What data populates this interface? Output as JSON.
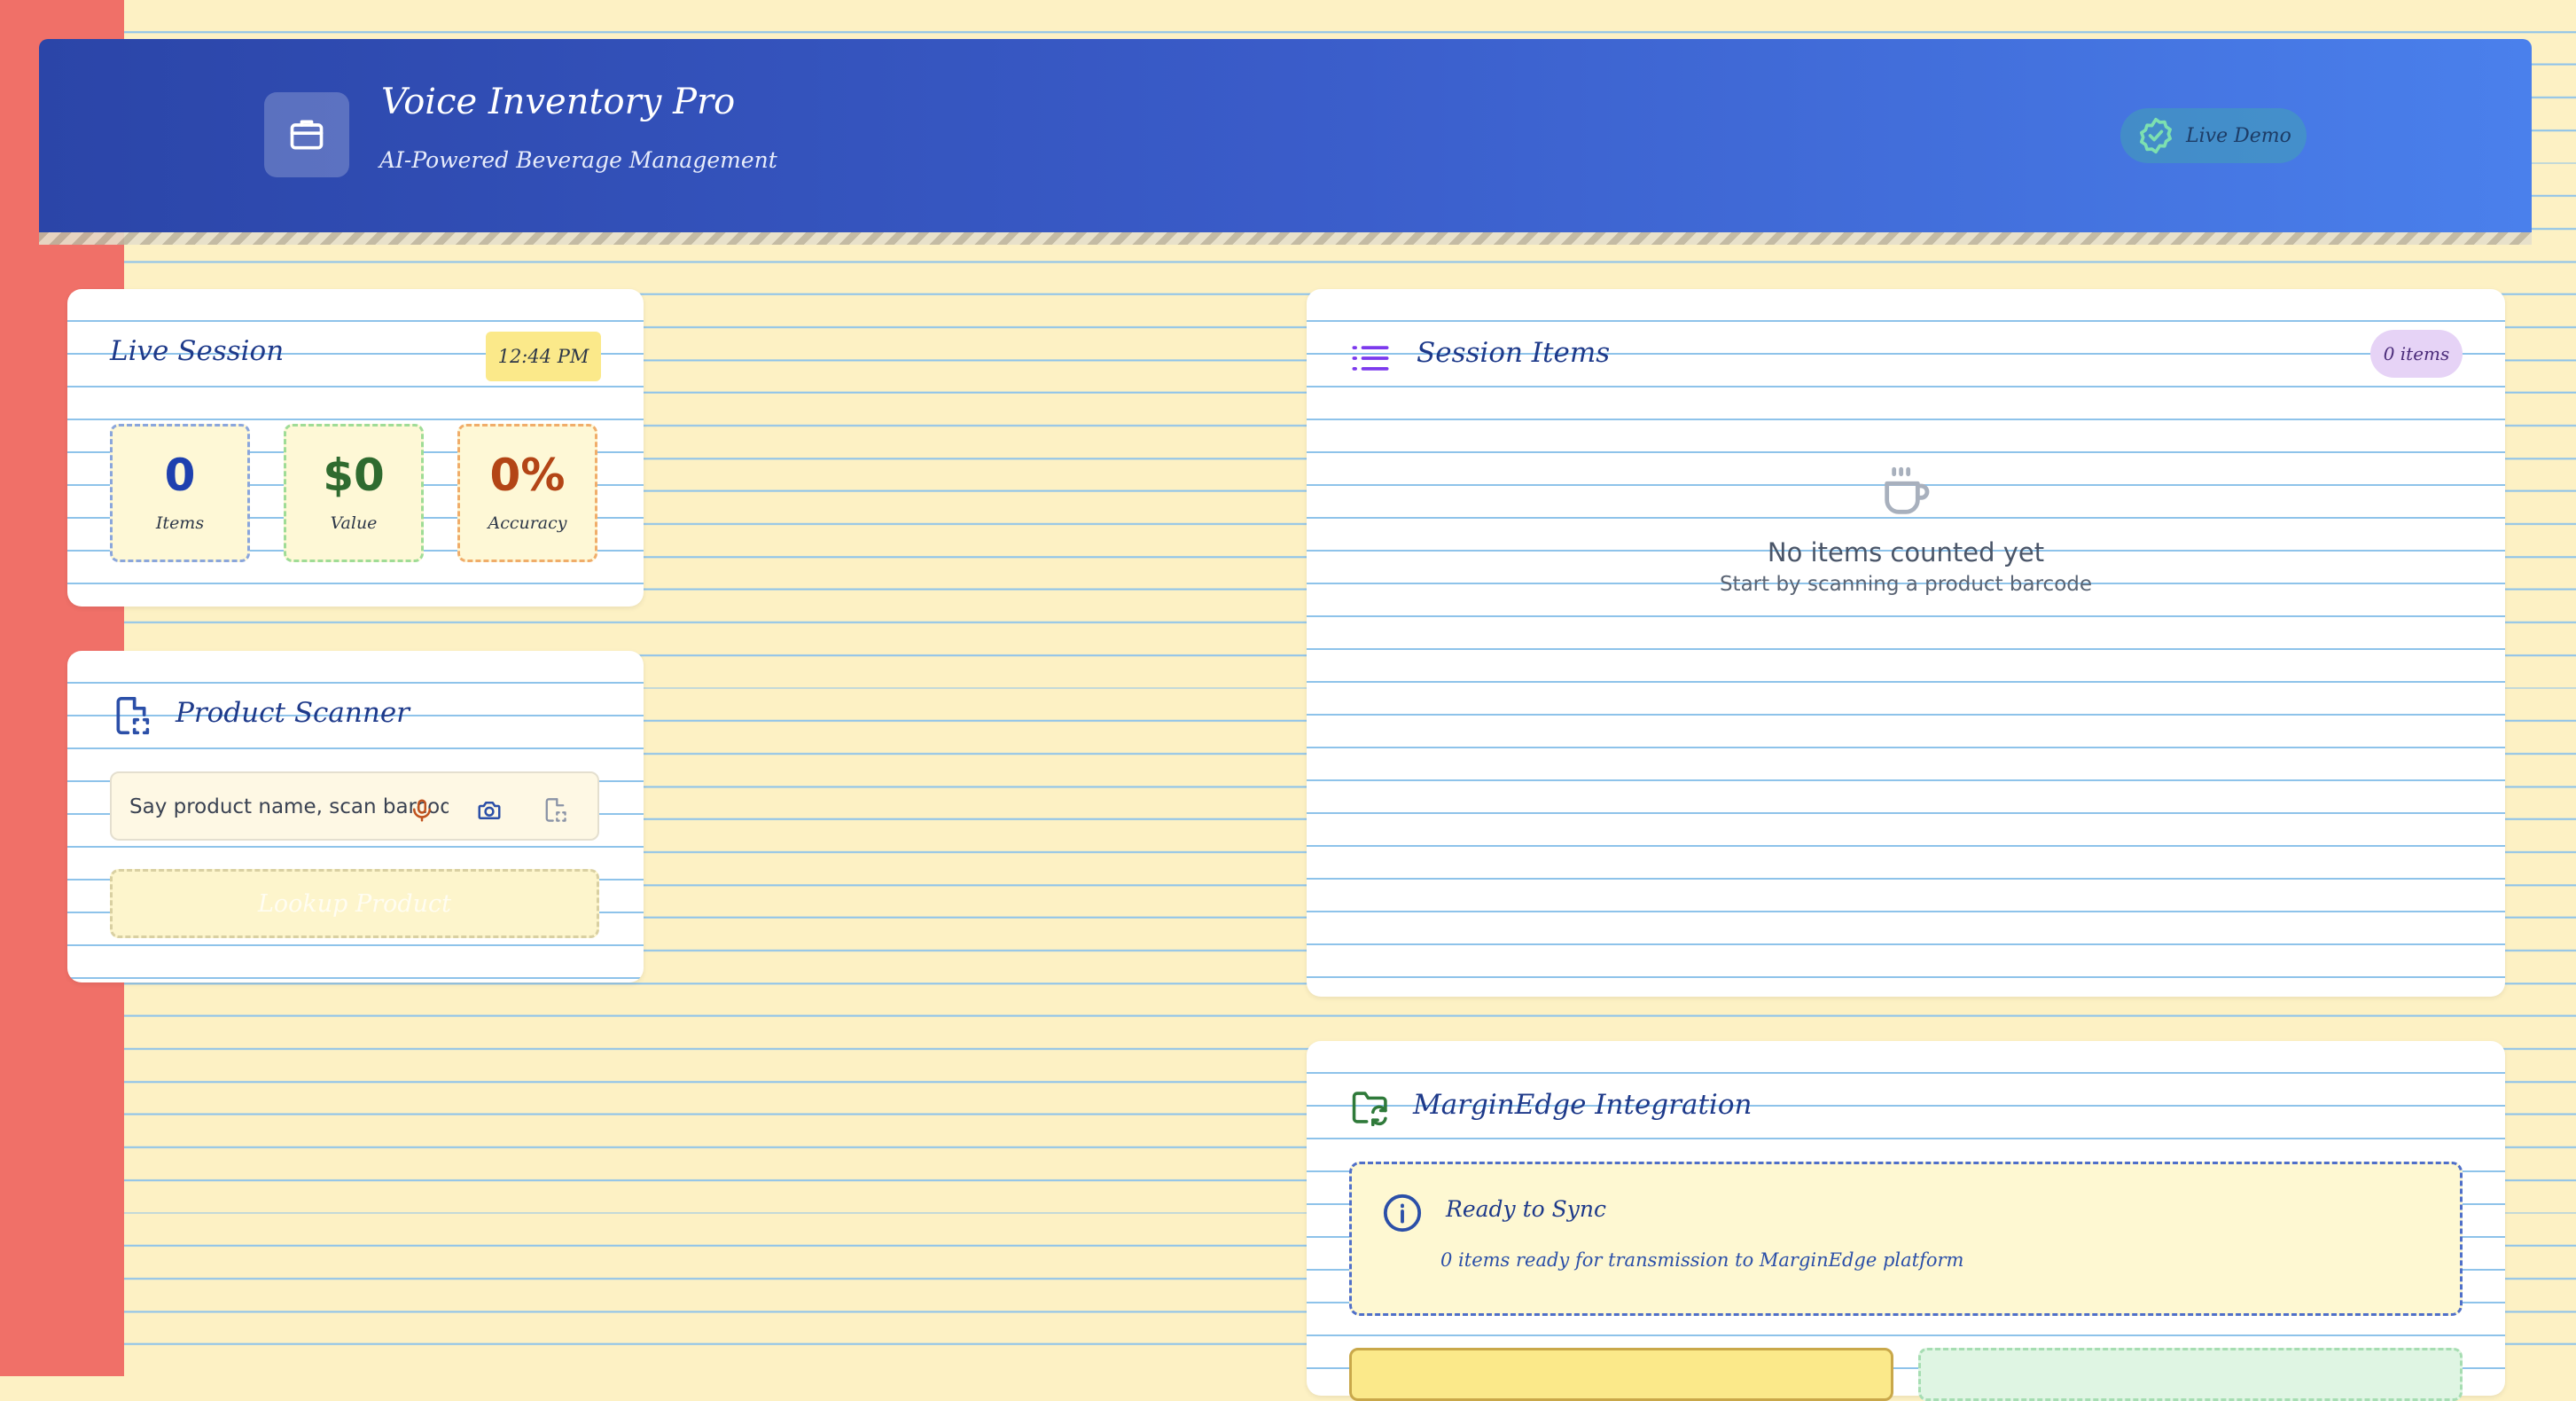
{
  "header": {
    "title": "Voice Inventory Pro",
    "subtitle": "AI-Powered Beverage Management",
    "status": "Live Demo"
  },
  "session": {
    "title": "Live Session",
    "time": "12:44 PM",
    "stats": [
      {
        "value": "0",
        "label": "Items"
      },
      {
        "value": "$0",
        "label": "Value"
      },
      {
        "value": "0%",
        "label": "Accuracy"
      }
    ]
  },
  "scanner": {
    "title": "Product Scanner",
    "placeholder": "Say product name, scan barcode, o",
    "lookup_label": "Lookup Product"
  },
  "session_items": {
    "title": "Session Items",
    "count_badge": "0 items",
    "empty_title": "No items counted yet",
    "empty_subtitle": "Start by scanning a product barcode"
  },
  "integration": {
    "title": "MarginEdge Integration",
    "status_title": "Ready to Sync",
    "status_desc": "0 items ready for transmission to MarginEdge platform"
  },
  "colors": {
    "brand_blue": "#2b45a8",
    "items_blue": "#1e40af",
    "value_green": "#2f6b2f",
    "accuracy_orange": "#b34516",
    "margin_red": "#f07068"
  }
}
